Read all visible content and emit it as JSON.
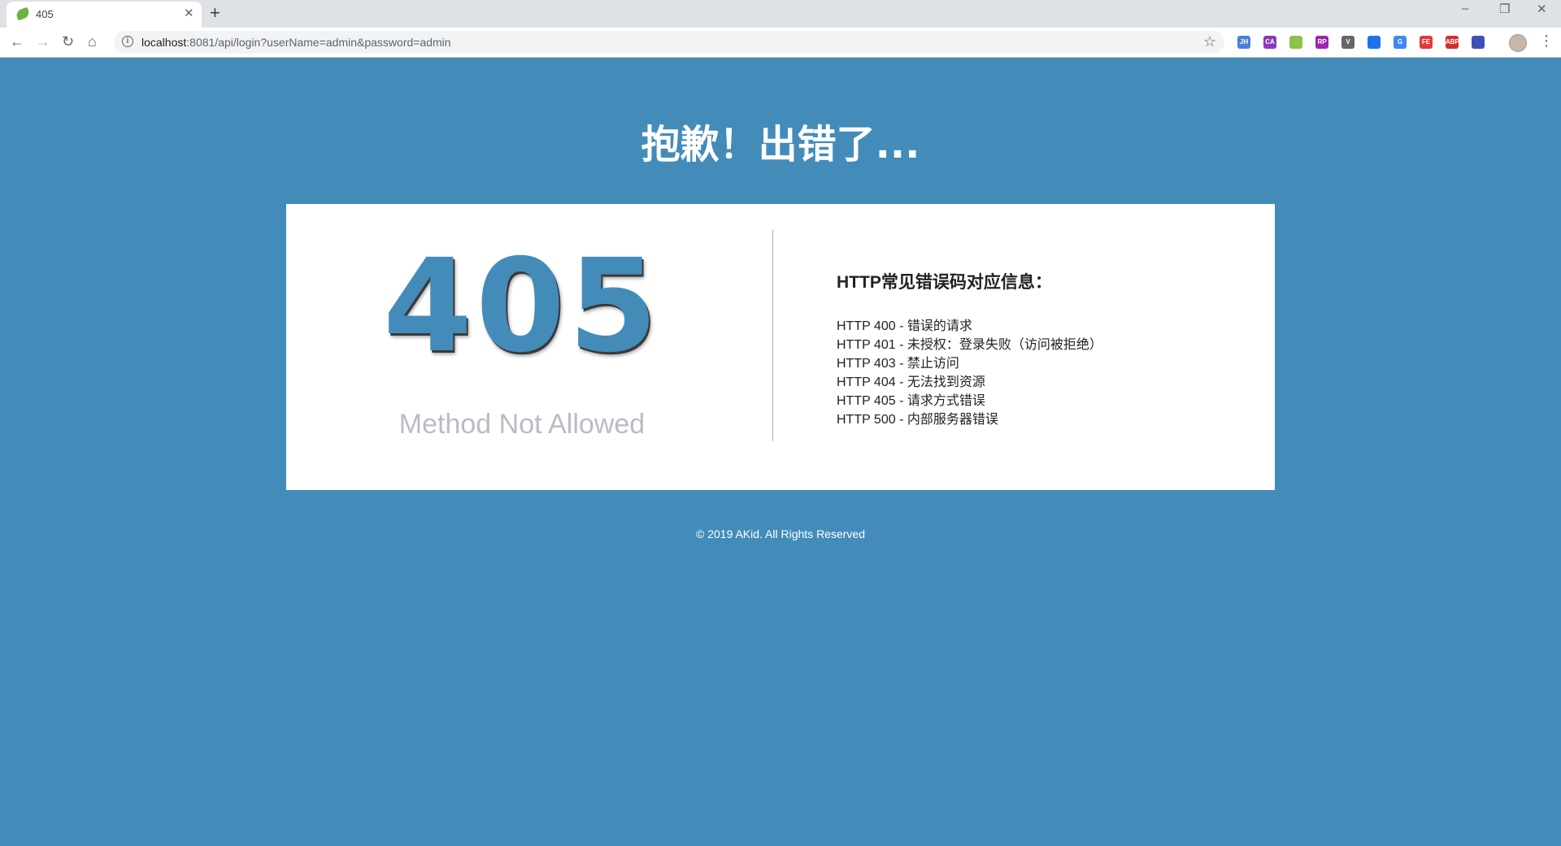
{
  "browser": {
    "tab": {
      "title": "405",
      "close_glyph": "✕"
    },
    "new_tab_glyph": "+",
    "window_controls": {
      "minimize": "–",
      "restore": "❐",
      "close": "✕"
    },
    "nav": {
      "back": "←",
      "forward": "→",
      "reload": "↻",
      "home": "⌂"
    },
    "url": {
      "host": "localhost",
      "rest": ":8081/api/login?userName=admin&password=admin"
    },
    "star_glyph": "☆",
    "extensions": [
      {
        "name": "jh-extension-icon",
        "label": "JH",
        "color": "#4a7fd9"
      },
      {
        "name": "ca-extension-icon",
        "label": "CA",
        "color": "#8a3ab9"
      },
      {
        "name": "green-extension-icon",
        "label": "",
        "color": "#8bc34a"
      },
      {
        "name": "rp-extension-icon",
        "label": "RP",
        "color": "#9c27b0"
      },
      {
        "name": "v-extension-icon",
        "label": "V",
        "color": "#666666"
      },
      {
        "name": "pocket-extension-icon",
        "label": "",
        "color": "#1e73e8"
      },
      {
        "name": "translate-extension-icon",
        "label": "G",
        "color": "#4285f4"
      },
      {
        "name": "fe-extension-icon",
        "label": "FE",
        "color": "#e53935"
      },
      {
        "name": "abp-extension-icon",
        "label": "ABP",
        "color": "#d32f2f"
      },
      {
        "name": "blue-extension-icon",
        "label": "",
        "color": "#3f51b5"
      }
    ],
    "menu_glyph": "⋮"
  },
  "page": {
    "title": "抱歉！出错了...",
    "error_code": "405",
    "error_text": "Method Not Allowed",
    "info_heading": "HTTP常见错误码对应信息：",
    "codes": [
      "HTTP 400 - 错误的请求",
      "HTTP 401 - 未授权：登录失败（访问被拒绝）",
      "HTTP 403 - 禁止访问",
      "HTTP 404 - 无法找到资源",
      "HTTP 405 - 请求方式错误",
      "HTTP 500 - 内部服务器错误"
    ],
    "footer": "© 2019 AKid. All Rights Reserved"
  },
  "colors": {
    "background": "#438cba",
    "card": "#ffffff",
    "code": "#438cba"
  }
}
